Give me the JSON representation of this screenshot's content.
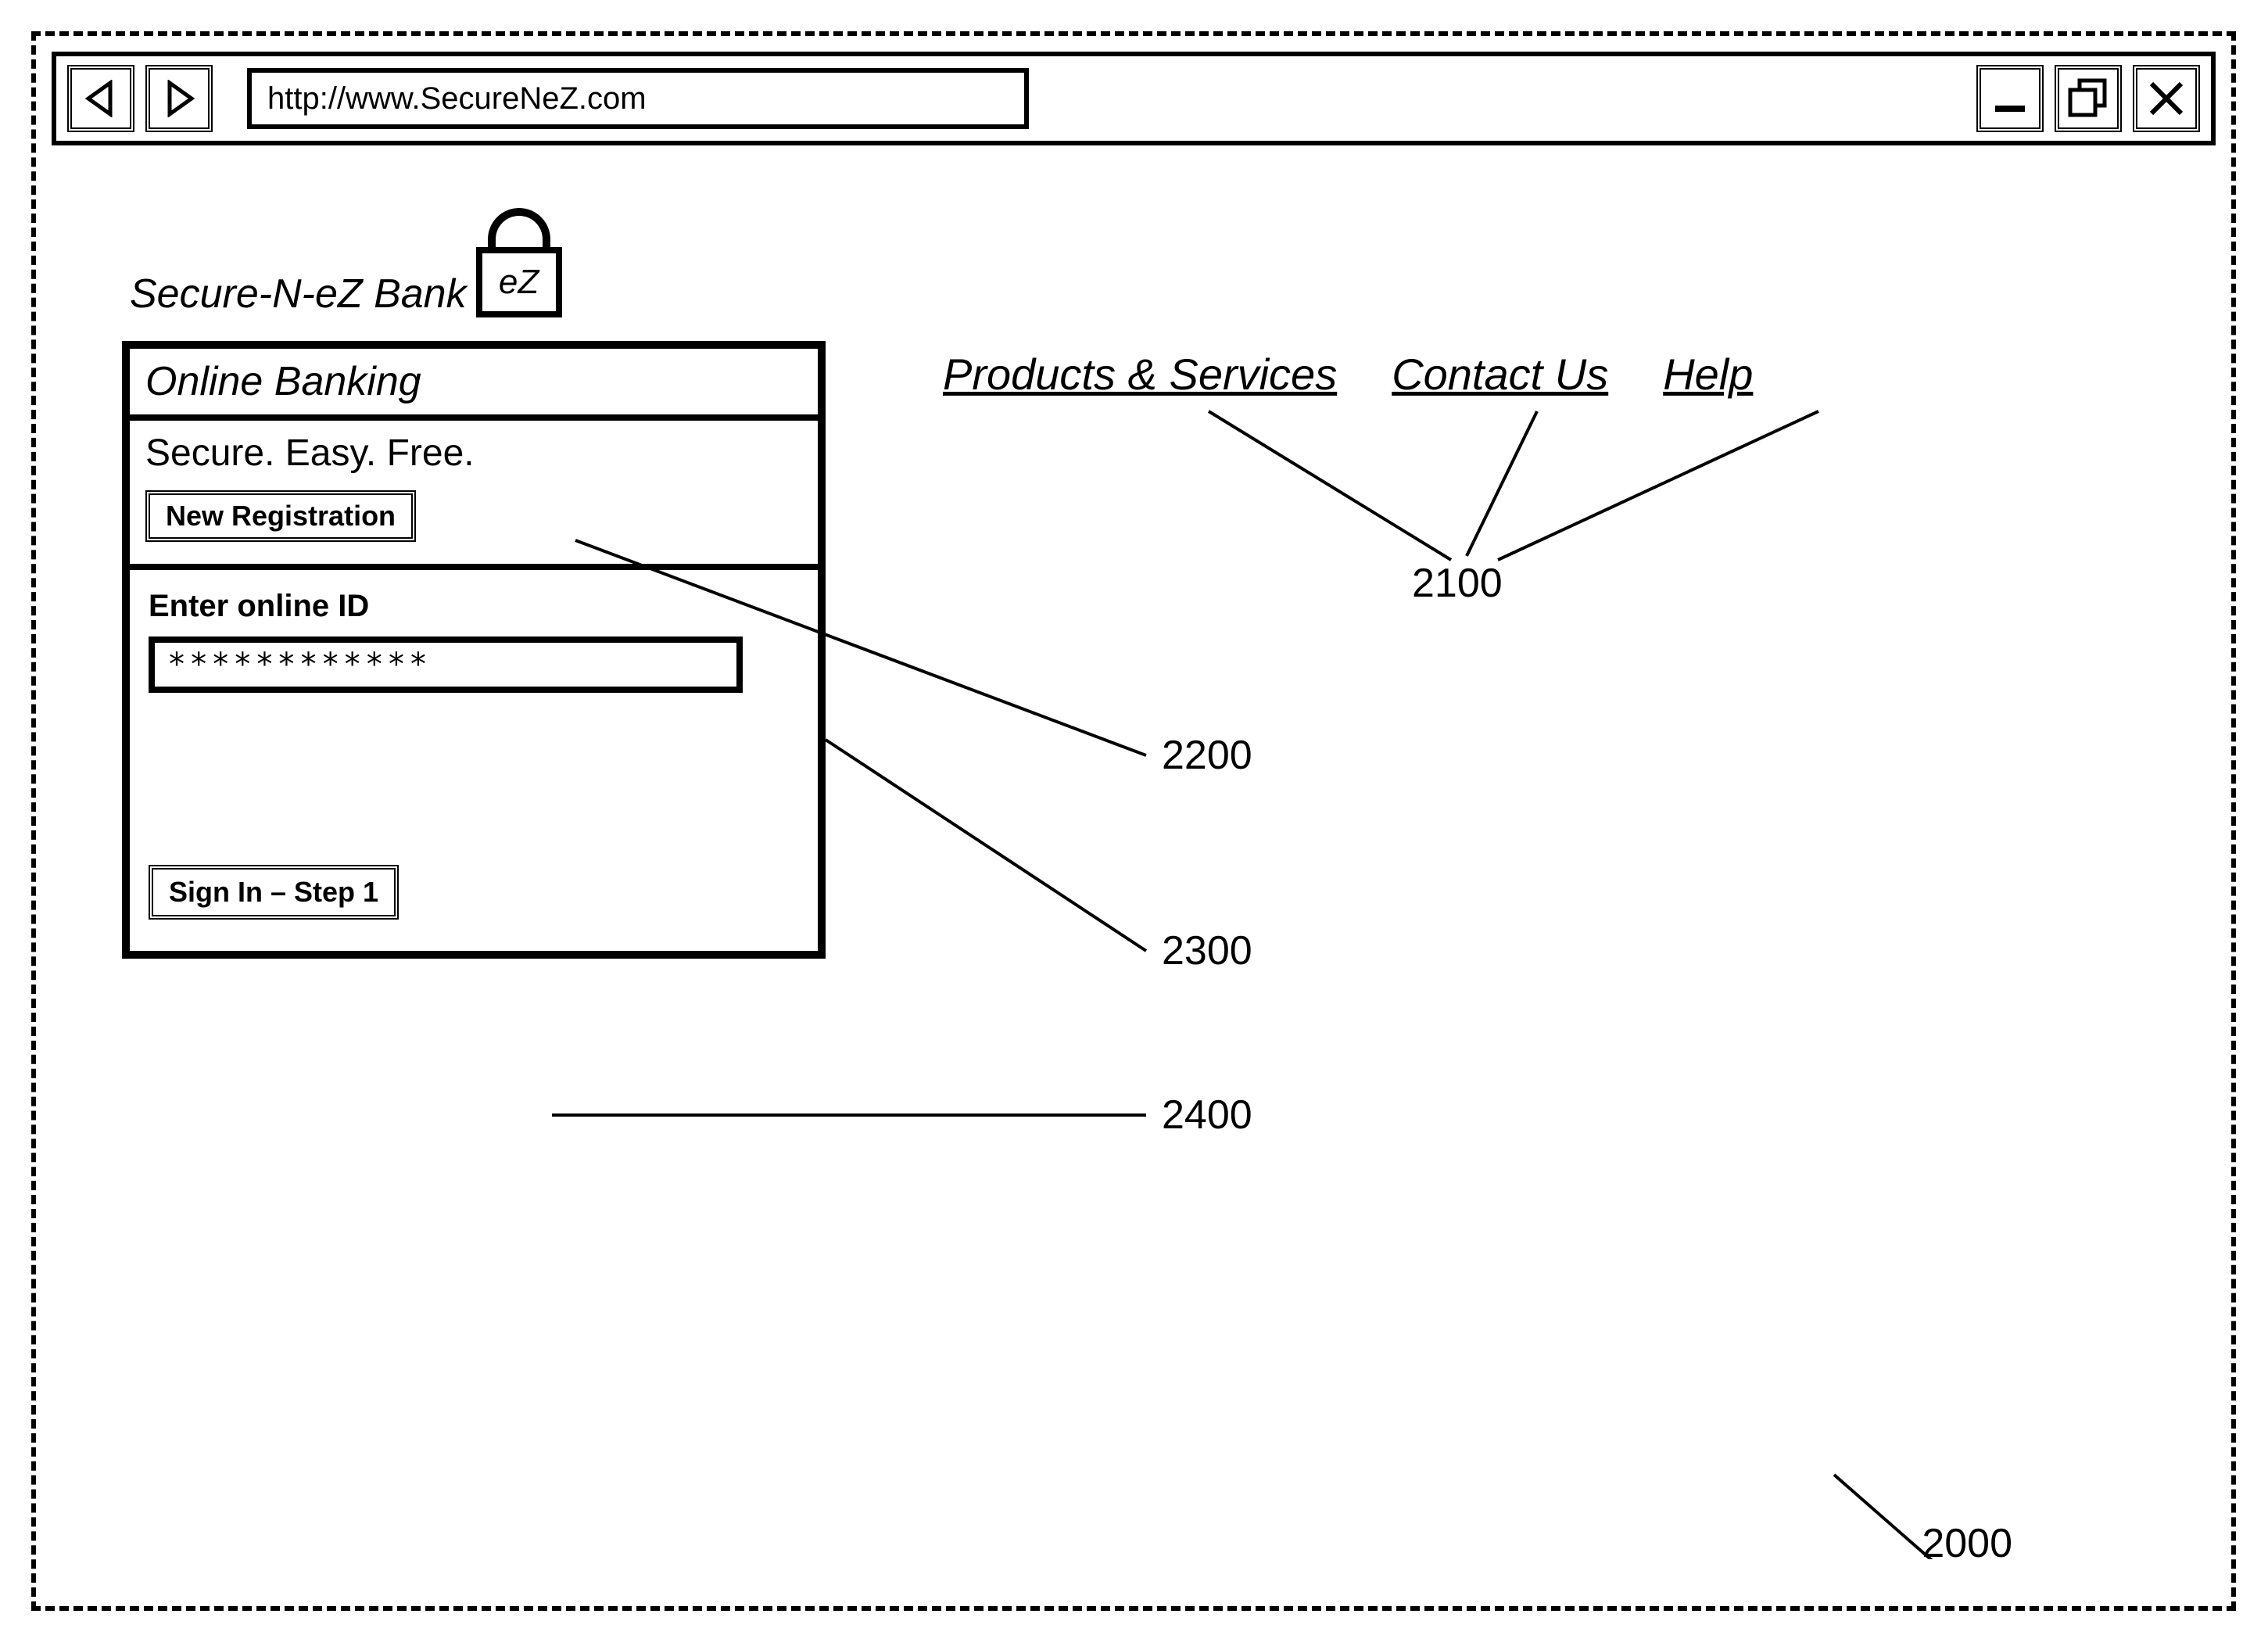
{
  "browser": {
    "url": "http://www.SecureNeZ.com"
  },
  "brand": {
    "name": "Secure-N-eZ Bank",
    "lock_label": "eZ"
  },
  "nav": {
    "products": "Products & Services",
    "contact": "Contact Us",
    "help": "Help"
  },
  "panel": {
    "header": "Online Banking",
    "tagline": "Secure. Easy. Free.",
    "new_registration": "New Registration",
    "enter_id_label": "Enter online ID",
    "id_value": "************",
    "signin": "Sign In – Step 1"
  },
  "refs": {
    "r2000": "2000",
    "r2100": "2100",
    "r2200": "2200",
    "r2300": "2300",
    "r2400": "2400"
  }
}
